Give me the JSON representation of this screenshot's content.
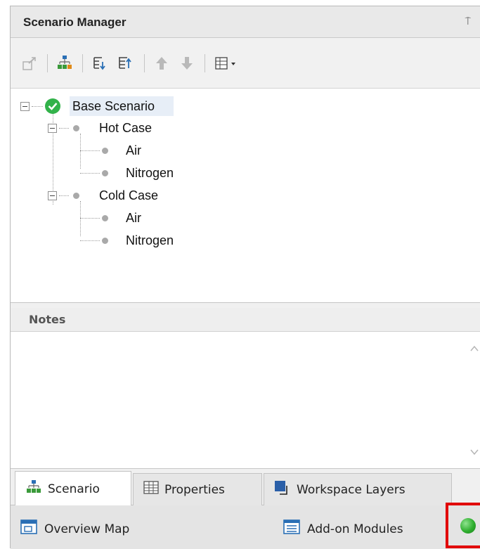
{
  "panel": {
    "title": "Scenario Manager",
    "pin_glyph": "⍑"
  },
  "toolbar": {
    "buttons": [
      {
        "icon": "promote-scenario-icon",
        "enabled": false
      },
      {
        "icon": "create-child-scenario-icon",
        "enabled": true
      },
      {
        "icon": "expand-tree-icon",
        "enabled": true
      },
      {
        "icon": "collapse-tree-icon",
        "enabled": true
      },
      {
        "icon": "move-up-arrow-icon",
        "enabled": false
      },
      {
        "icon": "move-down-arrow-icon",
        "enabled": false
      },
      {
        "icon": "view-options-dropdown-icon",
        "enabled": true
      }
    ]
  },
  "tree": {
    "root": "Base Scenario",
    "hot_case": "Hot Case",
    "hot_air": "Air",
    "hot_nitrogen": "Nitrogen",
    "cold_case": "Cold Case",
    "cold_air": "Air",
    "cold_nitrogen": "Nitrogen"
  },
  "notes": {
    "header": "Notes",
    "content": ""
  },
  "tabs": {
    "scenario": "Scenario",
    "properties": "Properties",
    "workspace_layers": "Workspace Layers"
  },
  "statusbar": {
    "overview_map": "Overview Map",
    "addon_modules": "Add-on Modules"
  },
  "colors": {
    "check_green": "#32b24a",
    "highlight_red": "#e10000",
    "status_green": "#2fae2f"
  }
}
